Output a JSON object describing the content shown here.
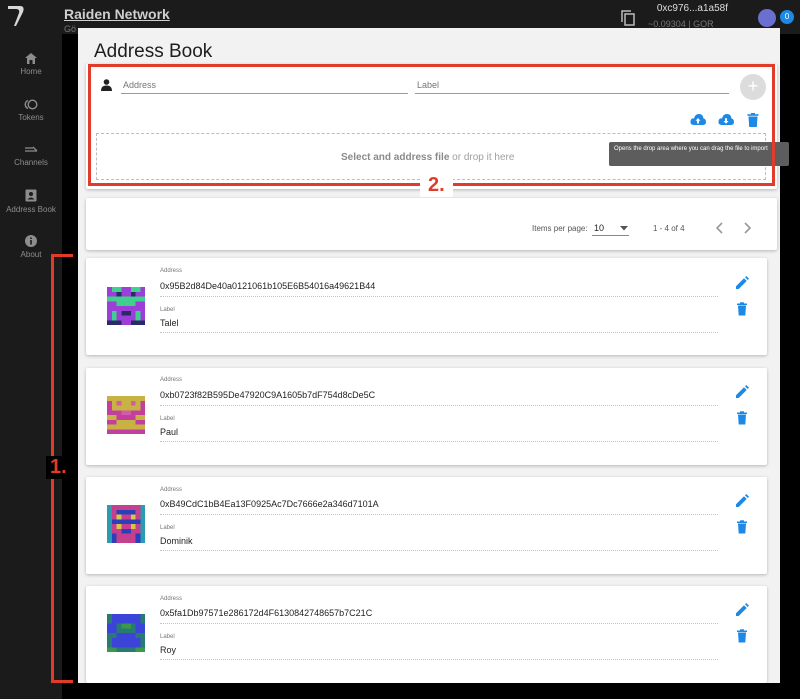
{
  "app": {
    "title": "Raiden Network",
    "subtitle": "Gö"
  },
  "account": {
    "address": "0xc976...a1a58f",
    "balance": "~0.09304 | GOR",
    "notifications": "0"
  },
  "sidebar": {
    "items": [
      {
        "label": "Home",
        "icon": "home-icon"
      },
      {
        "label": "Tokens",
        "icon": "tokens-icon"
      },
      {
        "label": "Channels",
        "icon": "channels-icon"
      },
      {
        "label": "Address Book",
        "icon": "address-book-icon"
      },
      {
        "label": "About",
        "icon": "info-icon"
      }
    ]
  },
  "dialog": {
    "title": "Address Book",
    "form": {
      "address_placeholder": "Address",
      "label_placeholder": "Label",
      "add_symbol": "+"
    },
    "drop": {
      "strong": "Select and address file",
      "rest": " or drop it here"
    },
    "tooltip": "Opens the drop area where you can drag the file to import",
    "pagination": {
      "items_per_page_label": "Items per page:",
      "items_per_page": "10",
      "range": "1 - 4 of 4"
    },
    "entries": [
      {
        "address_label": "Address",
        "address": "0x95B2d84De40a0121061b105E6B54016a49621B44",
        "label_label": "Label",
        "label": "Talel"
      },
      {
        "address_label": "Address",
        "address": "0xb0723f82B595De47920C9A1605b7dF754d8cDe5C",
        "label_label": "Label",
        "label": "Paul"
      },
      {
        "address_label": "Address",
        "address": "0xB49CdC1bB4Ea13F0925Ac7Dc7666e2a346d7101A",
        "label_label": "Label",
        "label": "Dominik"
      },
      {
        "address_label": "Address",
        "address": "0x5fa1Db97571e286172d4F6130842748657b7C21C",
        "label_label": "Label",
        "label": "Roy"
      }
    ]
  },
  "annotations": {
    "marker_1": "1.",
    "marker_2": "2.",
    "color": "#e23b2a"
  },
  "colors": {
    "accent": "#1e88e5",
    "sidebar": "#1b1b1b",
    "dialog": "#f2f2f2"
  }
}
